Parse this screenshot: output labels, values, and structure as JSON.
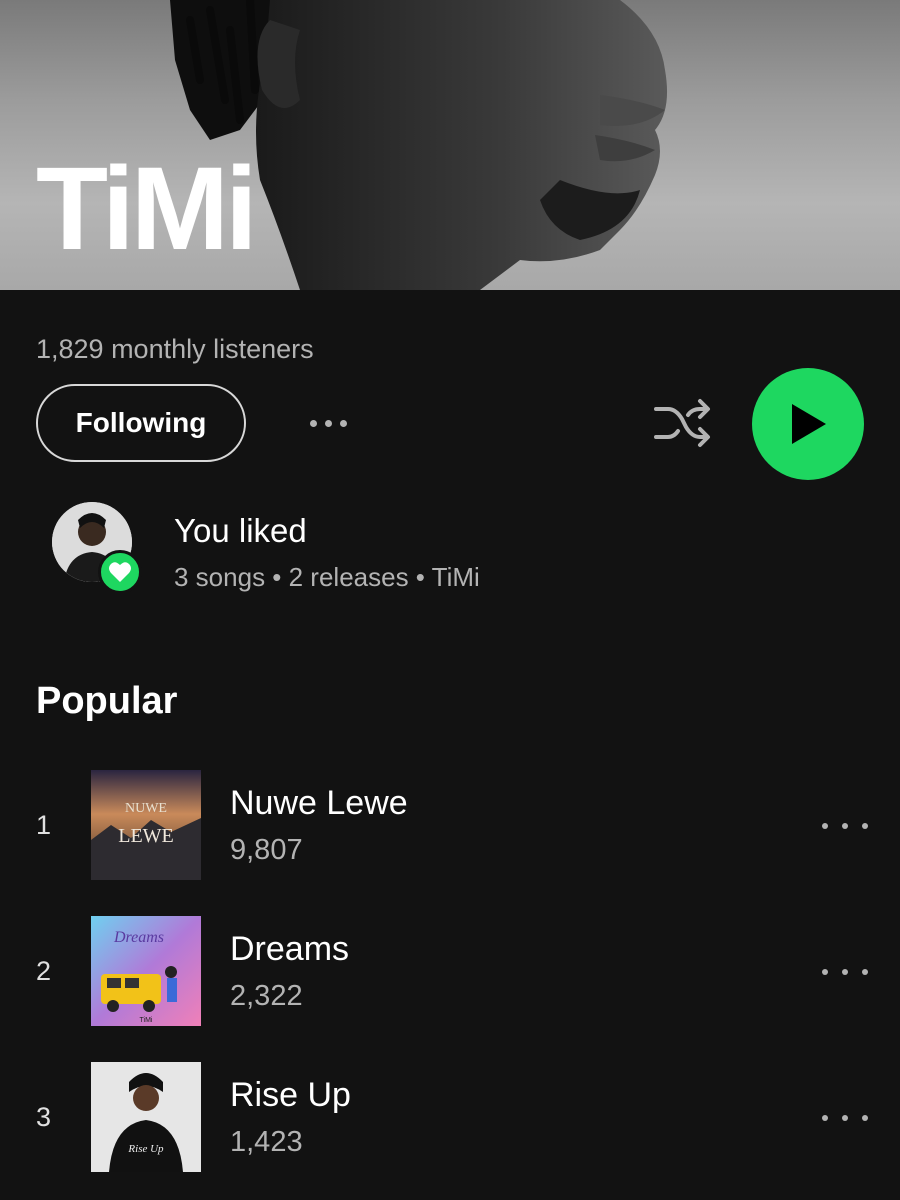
{
  "artist": {
    "name": "TiMi",
    "monthly_listeners": "1,829 monthly listeners"
  },
  "actions": {
    "follow_label": "Following"
  },
  "liked": {
    "title": "You liked",
    "subtitle": "3 songs • 2 releases • TiMi"
  },
  "popular": {
    "title": "Popular",
    "tracks": [
      {
        "number": "1",
        "title": "Nuwe Lewe",
        "plays": "9,807",
        "art_text": [
          "NUWE",
          "LEWE"
        ]
      },
      {
        "number": "2",
        "title": "Dreams",
        "plays": "2,322",
        "art_text": [
          "Dreams",
          "TiMi"
        ]
      },
      {
        "number": "3",
        "title": "Rise Up",
        "plays": "1,423",
        "art_text": [
          "Rise Up"
        ]
      }
    ]
  },
  "colors": {
    "background": "#121212",
    "accent_green": "#1ed760",
    "secondary_text": "#b3b3b3"
  },
  "icons": [
    "more-icon",
    "shuffle-icon",
    "play-icon",
    "heart-icon"
  ]
}
